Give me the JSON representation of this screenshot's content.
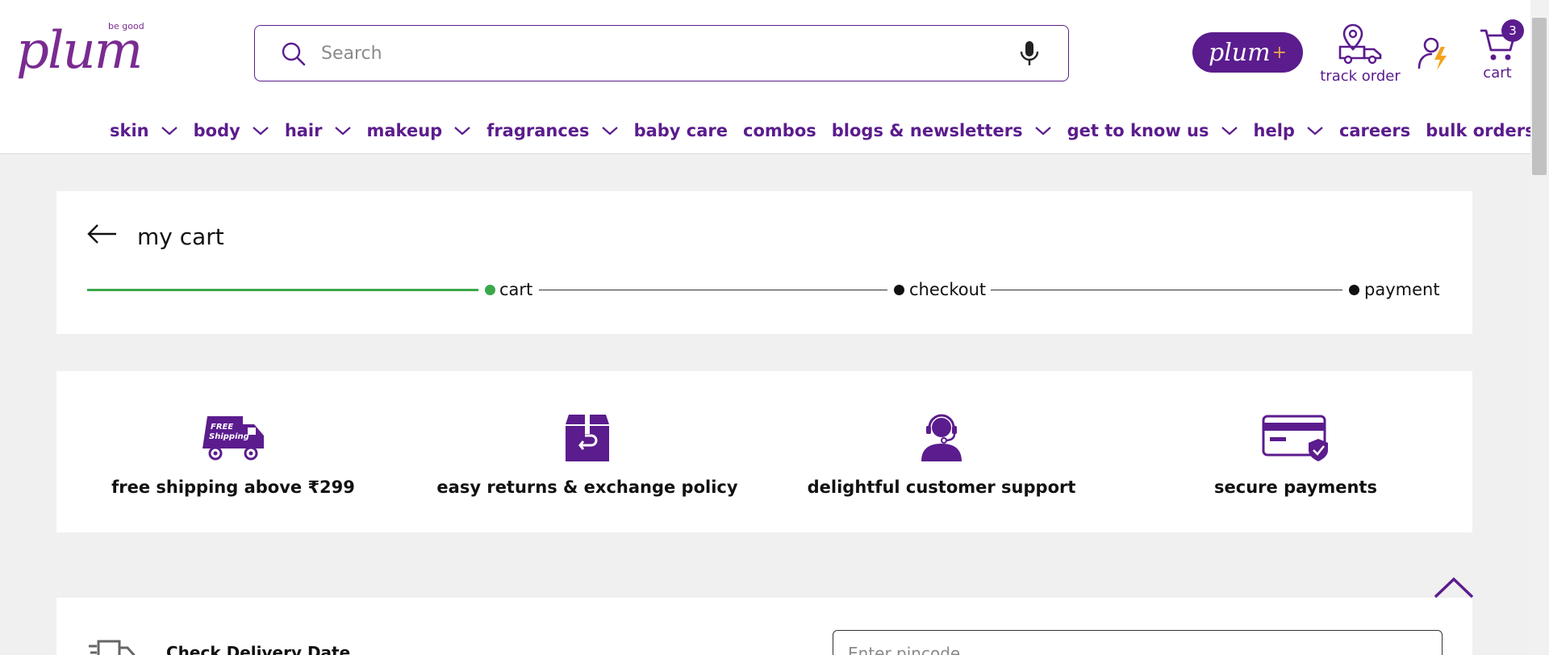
{
  "header": {
    "logo_text": "plum",
    "logo_tagline": "be good",
    "search": {
      "placeholder": "Search",
      "value": ""
    },
    "plum_plus_label": "plum",
    "plum_plus_symbol": "+",
    "track_order_label": "track order",
    "cart_label": "cart",
    "cart_count": "3"
  },
  "nav": {
    "items": [
      {
        "label": "skin",
        "has_dropdown": true
      },
      {
        "label": "body",
        "has_dropdown": true
      },
      {
        "label": "hair",
        "has_dropdown": true
      },
      {
        "label": "makeup",
        "has_dropdown": true
      },
      {
        "label": "fragrances",
        "has_dropdown": true
      },
      {
        "label": "baby care",
        "has_dropdown": false
      },
      {
        "label": "combos",
        "has_dropdown": false
      },
      {
        "label": "blogs & newsletters",
        "has_dropdown": true
      },
      {
        "label": "get to know us",
        "has_dropdown": true
      },
      {
        "label": "help",
        "has_dropdown": true
      },
      {
        "label": "careers",
        "has_dropdown": false
      },
      {
        "label": "bulk orders",
        "has_dropdown": false
      }
    ]
  },
  "cart_page": {
    "title": "my cart",
    "steps": [
      {
        "label": "cart",
        "status": "active"
      },
      {
        "label": "checkout",
        "status": "pending"
      },
      {
        "label": "payment",
        "status": "pending"
      }
    ]
  },
  "features": [
    {
      "icon": "free-shipping-truck-icon",
      "icon_text": "FREE Shipping",
      "label": "free shipping above ₹299"
    },
    {
      "icon": "return-box-icon",
      "label": "easy returns & exchange policy"
    },
    {
      "icon": "customer-support-icon",
      "label": "delightful customer support"
    },
    {
      "icon": "secure-card-icon",
      "label": "secure payments"
    }
  ],
  "delivery": {
    "label": "Check Delivery Date",
    "pincode_placeholder": "Enter pincode"
  },
  "colors": {
    "brand_purple": "#5b1c8d",
    "logo_purple": "#7a2b91",
    "progress_green": "#3aa84b",
    "accent_orange": "#e8a94c"
  }
}
